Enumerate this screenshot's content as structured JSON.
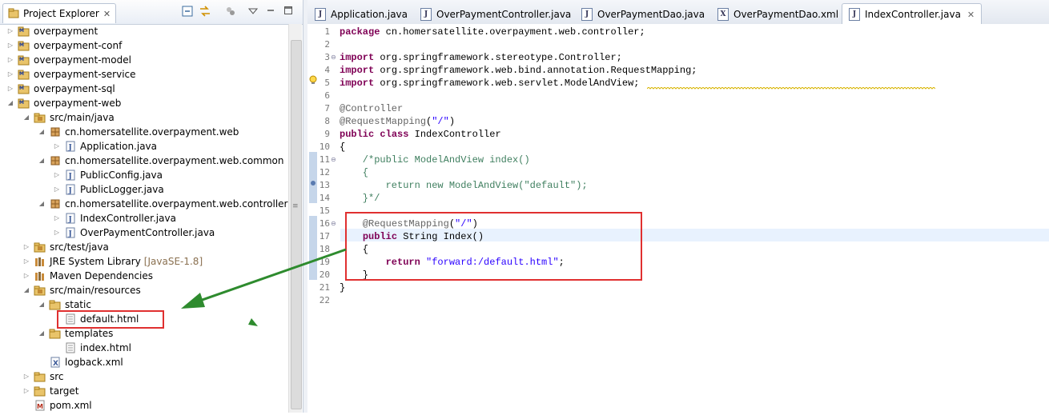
{
  "explorer": {
    "title": "Project Explorer",
    "close": "✕",
    "items": [
      {
        "label": "overpayment",
        "icon": "maven-project-icon",
        "twisty": "▷"
      },
      {
        "label": "overpayment-conf",
        "icon": "maven-project-icon",
        "twisty": "▷"
      },
      {
        "label": "overpayment-model",
        "icon": "maven-project-icon",
        "twisty": "▷"
      },
      {
        "label": "overpayment-service",
        "icon": "maven-project-icon",
        "twisty": "▷"
      },
      {
        "label": "overpayment-sql",
        "icon": "maven-project-icon",
        "twisty": "▷"
      },
      {
        "label": "overpayment-web",
        "icon": "maven-project-icon",
        "twisty": "◢"
      },
      {
        "label": "src/main/java",
        "icon": "source-folder-icon",
        "twisty": "◢"
      },
      {
        "label": "cn.homersatellite.overpayment.web",
        "icon": "package-icon",
        "twisty": "◢"
      },
      {
        "label": "Application.java",
        "icon": "java-file-icon",
        "twisty": "▷"
      },
      {
        "label": "cn.homersatellite.overpayment.web.common",
        "icon": "package-icon",
        "twisty": "◢"
      },
      {
        "label": "PublicConfig.java",
        "icon": "java-file-icon",
        "twisty": "▷"
      },
      {
        "label": "PublicLogger.java",
        "icon": "java-file-icon",
        "twisty": "▷"
      },
      {
        "label": "cn.homersatellite.overpayment.web.controller",
        "icon": "package-icon",
        "twisty": "◢"
      },
      {
        "label": "IndexController.java",
        "icon": "java-file-icon",
        "twisty": "▷"
      },
      {
        "label": "OverPaymentController.java",
        "icon": "java-file-icon",
        "twisty": "▷"
      },
      {
        "label": "src/test/java",
        "icon": "source-folder-icon",
        "twisty": "▷"
      },
      {
        "label": "JRE System Library",
        "extra": "[JavaSE-1.8]",
        "icon": "library-icon",
        "twisty": "▷"
      },
      {
        "label": "Maven Dependencies",
        "icon": "library-icon",
        "twisty": "▷"
      },
      {
        "label": "src/main/resources",
        "icon": "source-folder-icon",
        "twisty": "◢"
      },
      {
        "label": "static",
        "icon": "folder-icon",
        "twisty": "◢"
      },
      {
        "label": "default.html",
        "icon": "html-file-icon",
        "twisty": ""
      },
      {
        "label": "templates",
        "icon": "folder-icon",
        "twisty": "◢"
      },
      {
        "label": "index.html",
        "icon": "html-file-icon",
        "twisty": ""
      },
      {
        "label": "logback.xml",
        "icon": "xml-file-icon",
        "twisty": ""
      },
      {
        "label": "src",
        "icon": "folder-icon",
        "twisty": "▷"
      },
      {
        "label": "target",
        "icon": "folder-icon",
        "twisty": "▷"
      },
      {
        "label": "pom.xml",
        "icon": "maven-pom-icon",
        "twisty": ""
      }
    ]
  },
  "editor": {
    "tabs": [
      {
        "label": "Application.java",
        "icon": "J",
        "active": false
      },
      {
        "label": "OverPaymentController.java",
        "icon": "J",
        "active": false
      },
      {
        "label": "OverPaymentDao.java",
        "icon": "J",
        "active": false
      },
      {
        "label": "OverPaymentDao.xml",
        "icon": "X",
        "active": false
      },
      {
        "label": "IndexController.java",
        "icon": "J",
        "active": true
      }
    ],
    "tab_close": "✕",
    "lines": [
      {
        "n": "1",
        "fold": "",
        "tokens": [
          [
            "kw",
            "package"
          ],
          [
            "t",
            " cn.homersatellite.overpayment.web.controller;"
          ]
        ]
      },
      {
        "n": "2",
        "fold": "",
        "tokens": []
      },
      {
        "n": "3",
        "fold": "⊖",
        "tokens": [
          [
            "kw",
            "import"
          ],
          [
            "t",
            " org.springframework.stereotype.Controller;"
          ]
        ]
      },
      {
        "n": "4",
        "fold": "",
        "tokens": [
          [
            "kw",
            "import"
          ],
          [
            "t",
            " org.springframework.web.bind.annotation.RequestMapping;"
          ]
        ]
      },
      {
        "n": "5",
        "fold": "",
        "tokens": [
          [
            "kw",
            "import"
          ],
          [
            "t",
            " org.springframework.web.servlet.ModelAndView;"
          ]
        ]
      },
      {
        "n": "6",
        "fold": "",
        "tokens": []
      },
      {
        "n": "7",
        "fold": "",
        "tokens": [
          [
            "an",
            "@Controller"
          ]
        ]
      },
      {
        "n": "8",
        "fold": "",
        "tokens": [
          [
            "an",
            "@RequestMapping"
          ],
          [
            "t",
            "("
          ],
          [
            "st",
            "\"/\""
          ],
          [
            "t",
            ")"
          ]
        ]
      },
      {
        "n": "9",
        "fold": "",
        "tokens": [
          [
            "kw",
            "public"
          ],
          [
            "t",
            " "
          ],
          [
            "kw",
            "class"
          ],
          [
            "t",
            " IndexController"
          ]
        ]
      },
      {
        "n": "10",
        "fold": "",
        "tokens": [
          [
            "t",
            "{"
          ]
        ]
      },
      {
        "n": "11",
        "fold": "⊖",
        "tokens": [
          [
            "cm",
            "    /*public ModelAndView index()"
          ]
        ]
      },
      {
        "n": "12",
        "fold": "",
        "tokens": [
          [
            "cm",
            "    {"
          ]
        ]
      },
      {
        "n": "13",
        "fold": "",
        "tokens": [
          [
            "cm",
            "        return new ModelAndView(\"default\");"
          ]
        ]
      },
      {
        "n": "14",
        "fold": "",
        "tokens": [
          [
            "cm",
            "    }*/"
          ]
        ]
      },
      {
        "n": "15",
        "fold": "",
        "tokens": []
      },
      {
        "n": "16",
        "fold": "⊖",
        "tokens": [
          [
            "t",
            "    "
          ],
          [
            "an",
            "@RequestMapping"
          ],
          [
            "t",
            "("
          ],
          [
            "st",
            "\"/\""
          ],
          [
            "t",
            ")"
          ]
        ]
      },
      {
        "n": "17",
        "fold": "",
        "tokens": [
          [
            "t",
            "    "
          ],
          [
            "kw",
            "public"
          ],
          [
            "t",
            " String Index()"
          ]
        ]
      },
      {
        "n": "18",
        "fold": "",
        "tokens": [
          [
            "t",
            "    {"
          ]
        ]
      },
      {
        "n": "19",
        "fold": "",
        "tokens": [
          [
            "t",
            "        "
          ],
          [
            "kw",
            "return"
          ],
          [
            "t",
            " "
          ],
          [
            "st",
            "\"forward:/default.html\""
          ],
          [
            "t",
            ";"
          ]
        ]
      },
      {
        "n": "20",
        "fold": "",
        "tokens": [
          [
            "t",
            "    }"
          ]
        ]
      },
      {
        "n": "21",
        "fold": "",
        "tokens": [
          [
            "t",
            "}"
          ]
        ]
      },
      {
        "n": "22",
        "fold": "",
        "tokens": []
      }
    ]
  },
  "colors": {
    "highlight": "#e03030",
    "arrow": "#2e8b2e"
  }
}
